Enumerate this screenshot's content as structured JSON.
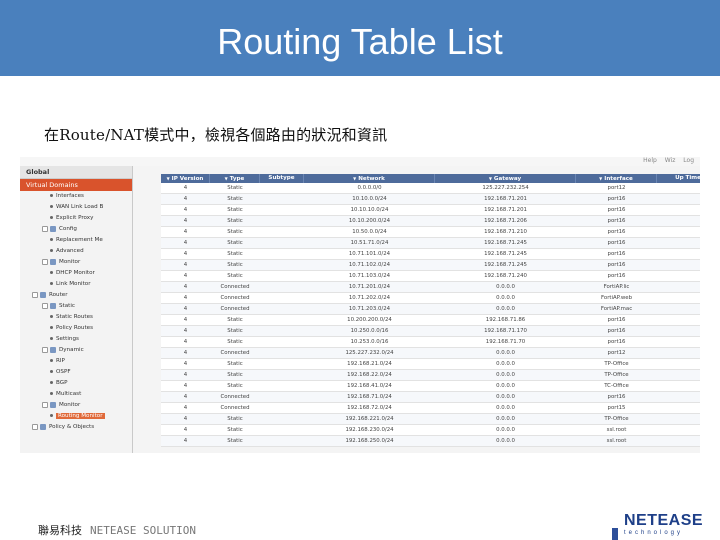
{
  "slide": {
    "title": "Routing Table List",
    "subtitle": "在Route/NAT模式中，檢視各個路由的狀況和資訊",
    "footer_text": "聯易科技",
    "footer_tail": "NETEASE SOLUTION",
    "logo_name": "NETEASE",
    "logo_tag": "technology",
    "colors": {
      "title_bar": "#4a80bd",
      "selected": "#d9532c",
      "grid_header": "#4e6b9b",
      "logo": "#1e3f88"
    }
  },
  "app": {
    "top_links": [
      "Help",
      "Wiz",
      "Log"
    ],
    "sidebar": {
      "global_label": "Global",
      "vdom_label": "Virtual Domains",
      "items": [
        {
          "label": "Interfaces",
          "icon": "dot",
          "indent": 30
        },
        {
          "label": "WAN Link Load B",
          "icon": "dot",
          "indent": 30
        },
        {
          "label": "Explicit Proxy",
          "icon": "dot",
          "indent": 30
        },
        {
          "label": "Config",
          "icon": "folder",
          "indent": 22
        },
        {
          "label": "Replacement Me",
          "icon": "dot",
          "indent": 30
        },
        {
          "label": "Advanced",
          "icon": "dot",
          "indent": 30
        },
        {
          "label": "Monitor",
          "icon": "folder",
          "indent": 22
        },
        {
          "label": "DHCP Monitor",
          "icon": "dot",
          "indent": 30
        },
        {
          "label": "Link Monitor",
          "icon": "dot",
          "indent": 30
        },
        {
          "label": "Router",
          "icon": "folder",
          "indent": 12
        },
        {
          "label": "Static",
          "icon": "folder",
          "indent": 22
        },
        {
          "label": "Static Routes",
          "icon": "dot",
          "indent": 30
        },
        {
          "label": "Policy Routes",
          "icon": "dot",
          "indent": 30
        },
        {
          "label": "Settings",
          "icon": "dot",
          "indent": 30
        },
        {
          "label": "Dynamic",
          "icon": "folder",
          "indent": 22
        },
        {
          "label": "RIP",
          "icon": "dot",
          "indent": 30
        },
        {
          "label": "OSPF",
          "icon": "dot",
          "indent": 30
        },
        {
          "label": "BGP",
          "icon": "dot",
          "indent": 30
        },
        {
          "label": "Multicast",
          "icon": "dot",
          "indent": 30
        },
        {
          "label": "Monitor",
          "icon": "folder",
          "indent": 22
        },
        {
          "label": "Routing Monitor",
          "icon": "dot",
          "indent": 30,
          "selected": true
        },
        {
          "label": "Policy & Objects",
          "icon": "folder",
          "indent": 12
        }
      ]
    },
    "table": {
      "columns": [
        "IP Version",
        "Type",
        "Subtype",
        "Network",
        "Gateway",
        "Interface",
        "Up Time"
      ],
      "rows": [
        [
          "4",
          "Static",
          "",
          "0.0.0.0/0",
          "125.227.232.254",
          "port12",
          ""
        ],
        [
          "4",
          "Static",
          "",
          "10.10.0.0/24",
          "192.168.71.201",
          "port16",
          ""
        ],
        [
          "4",
          "Static",
          "",
          "10.10.10.0/24",
          "192.168.71.201",
          "port16",
          ""
        ],
        [
          "4",
          "Static",
          "",
          "10.10.200.0/24",
          "192.168.71.206",
          "port16",
          ""
        ],
        [
          "4",
          "Static",
          "",
          "10.50.0.0/24",
          "192.168.71.210",
          "port16",
          ""
        ],
        [
          "4",
          "Static",
          "",
          "10.51.71.0/24",
          "192.168.71.245",
          "port16",
          ""
        ],
        [
          "4",
          "Static",
          "",
          "10.71.101.0/24",
          "192.168.71.245",
          "port16",
          ""
        ],
        [
          "4",
          "Static",
          "",
          "10.71.102.0/24",
          "192.168.71.245",
          "port16",
          ""
        ],
        [
          "4",
          "Static",
          "",
          "10.71.103.0/24",
          "192.168.71.240",
          "port16",
          ""
        ],
        [
          "4",
          "Connected",
          "",
          "10.71.201.0/24",
          "0.0.0.0",
          "FortiAP.lic",
          ""
        ],
        [
          "4",
          "Connected",
          "",
          "10.71.202.0/24",
          "0.0.0.0",
          "FortiAP.web",
          ""
        ],
        [
          "4",
          "Connected",
          "",
          "10.71.203.0/24",
          "0.0.0.0",
          "FortiAP.mac",
          ""
        ],
        [
          "4",
          "Static",
          "",
          "10.200.200.0/24",
          "192.168.71.86",
          "port16",
          ""
        ],
        [
          "4",
          "Static",
          "",
          "10.250.0.0/16",
          "192.168.71.170",
          "port16",
          ""
        ],
        [
          "4",
          "Static",
          "",
          "10.253.0.0/16",
          "192.168.71.70",
          "port16",
          ""
        ],
        [
          "4",
          "Connected",
          "",
          "125.227.232.0/24",
          "0.0.0.0",
          "port12",
          ""
        ],
        [
          "4",
          "Static",
          "",
          "192.168.21.0/24",
          "0.0.0.0",
          "TP-Office",
          ""
        ],
        [
          "4",
          "Static",
          "",
          "192.168.22.0/24",
          "0.0.0.0",
          "TP-Office",
          ""
        ],
        [
          "4",
          "Static",
          "",
          "192.168.41.0/24",
          "0.0.0.0",
          "TC-Office",
          ""
        ],
        [
          "4",
          "Connected",
          "",
          "192.168.71.0/24",
          "0.0.0.0",
          "port16",
          ""
        ],
        [
          "4",
          "Connected",
          "",
          "192.168.72.0/24",
          "0.0.0.0",
          "port15",
          ""
        ],
        [
          "4",
          "Static",
          "",
          "192.168.221.0/24",
          "0.0.0.0",
          "TP-Office",
          ""
        ],
        [
          "4",
          "Static",
          "",
          "192.168.230.0/24",
          "0.0.0.0",
          "ssl.root",
          ""
        ],
        [
          "4",
          "Static",
          "",
          "192.168.250.0/24",
          "0.0.0.0",
          "ssl.root",
          ""
        ]
      ]
    }
  }
}
